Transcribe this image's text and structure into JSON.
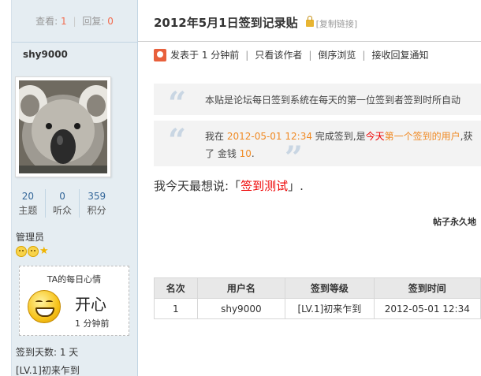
{
  "sidebar": {
    "views_label": "查看:",
    "views_count": "1",
    "replies_label": "回复:",
    "replies_count": "0",
    "username": "shy9000",
    "stats": [
      {
        "value": "20",
        "label": "主题"
      },
      {
        "value": "0",
        "label": "听众"
      },
      {
        "value": "359",
        "label": "积分"
      }
    ],
    "role": "管理员",
    "mood": {
      "title": "TA的每日心情",
      "text": "开心",
      "time": "1 分钟前"
    },
    "signin_days": "签到天数: 1 天",
    "level": "[LV.1]初来乍到"
  },
  "post": {
    "title": "2012年5月1日签到记录贴",
    "copy_link": "[复制链接]",
    "meta": {
      "posted": "发表于 1 分钟前",
      "author_only": "只看该作者",
      "reverse": "倒序浏览",
      "notify": "接收回复通知"
    },
    "quote1": "本贴是论坛每日签到系统在每天的第一位签到者签到时所自动",
    "quote2": {
      "prefix": "我在 ",
      "datetime": "2012-05-01 12:34",
      "mid": " 完成签到,是",
      "today": "今天",
      "first": "第一个签到的用户",
      "suffix": ",获",
      "line2_prefix": "了 金钱 ",
      "amount": "10",
      "line2_suffix": "."
    },
    "say": {
      "prefix": "我今天最想说:「",
      "content": "签到测试",
      "suffix": "」."
    },
    "permanent_note": "帖子永久地",
    "table": {
      "headers": [
        "名次",
        "用户名",
        "签到等级",
        "签到时间"
      ],
      "rows": [
        [
          "1",
          "shy9000",
          "[LV.1]初来乍到",
          "2012-05-01 12:34"
        ]
      ]
    }
  },
  "colors": {
    "sidebar_bg": "#e5edf2",
    "accent_orange": "#f08a24",
    "accent_red": "#ee0000",
    "link_blue": "#336699"
  }
}
